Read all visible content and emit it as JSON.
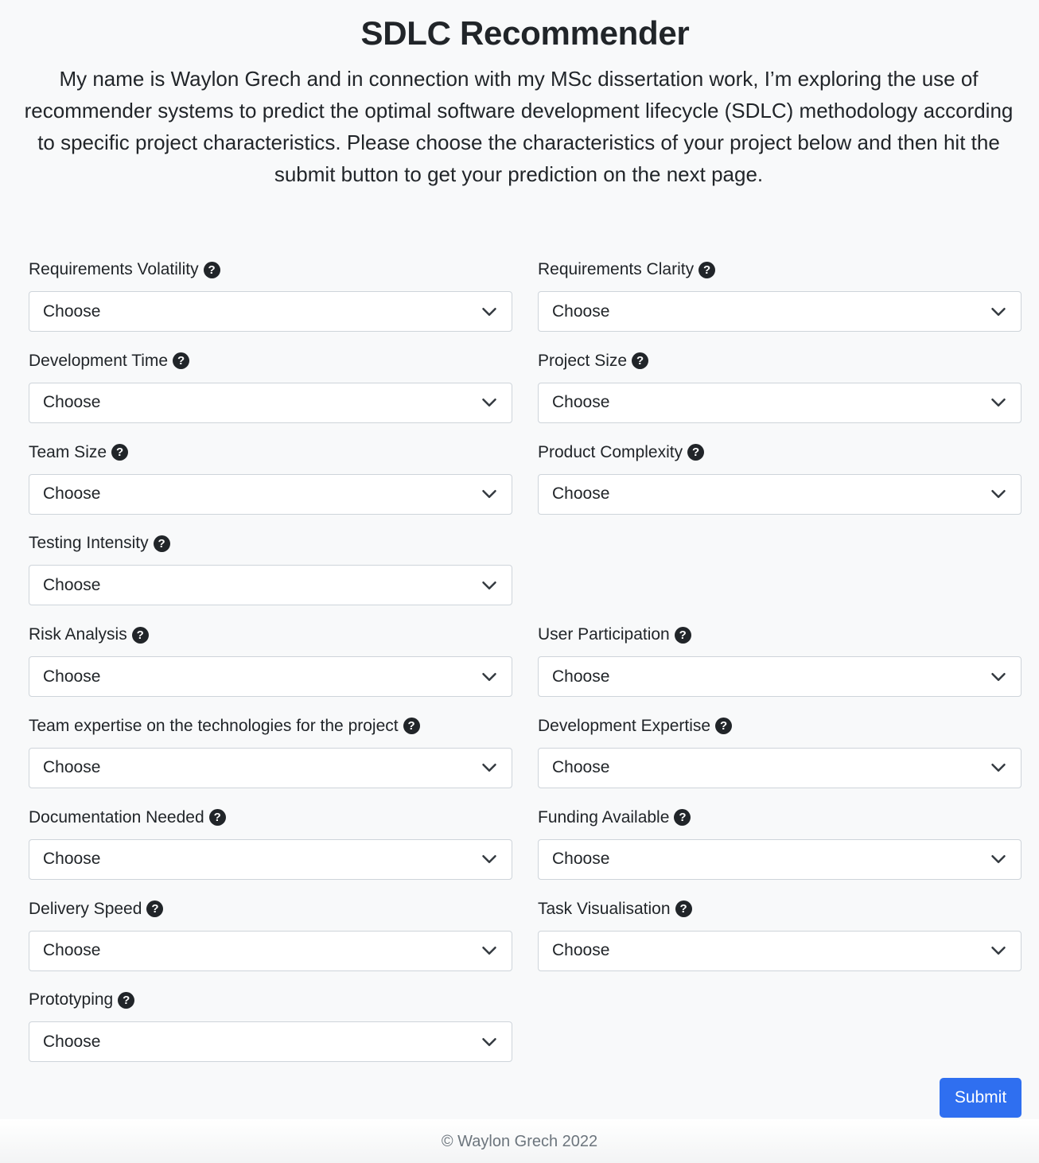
{
  "header": {
    "title": "SDLC Recommender",
    "intro": "My name is Waylon Grech and in connection with my MSc dissertation work, I’m exploring the use of recommender systems to predict the optimal software development lifecycle (SDLC) methodology according to specific project characteristics. Please choose the characteristics of your project below and then hit the submit button to get your prediction on the next page."
  },
  "form": {
    "rows": [
      [
        {
          "label": "Requirements Volatility",
          "value": "Choose"
        },
        {
          "label": "Requirements Clarity",
          "value": "Choose"
        }
      ],
      [
        {
          "label": "Development Time",
          "value": "Choose"
        },
        {
          "label": "Project Size",
          "value": "Choose"
        }
      ],
      [
        {
          "label": "Team Size",
          "value": "Choose"
        },
        {
          "label": "Product Complexity",
          "value": "Choose"
        }
      ],
      [
        {
          "label": "Testing Intensity",
          "value": "Choose"
        }
      ],
      [
        {
          "label": "Risk Analysis",
          "value": "Choose"
        },
        {
          "label": "User Participation",
          "value": "Choose"
        }
      ],
      [
        {
          "label": "Team expertise on the technologies for the project",
          "value": "Choose"
        },
        {
          "label": "Development Expertise",
          "value": "Choose"
        }
      ],
      [
        {
          "label": "Documentation Needed",
          "value": "Choose"
        },
        {
          "label": "Funding Available",
          "value": "Choose"
        }
      ],
      [
        {
          "label": "Delivery Speed",
          "value": "Choose"
        },
        {
          "label": "Task Visualisation",
          "value": "Choose"
        }
      ],
      [
        {
          "label": "Prototyping",
          "value": "Choose"
        }
      ]
    ],
    "help_icon": "question-circle-icon",
    "dropdown_icon": "chevron-down-icon",
    "submit_label": "Submit"
  },
  "footer": {
    "text": "© Waylon Grech 2022"
  },
  "colors": {
    "background": "#f8f9fa",
    "primary": "#2f6ff0",
    "text": "#212529",
    "muted": "#6c757d"
  }
}
